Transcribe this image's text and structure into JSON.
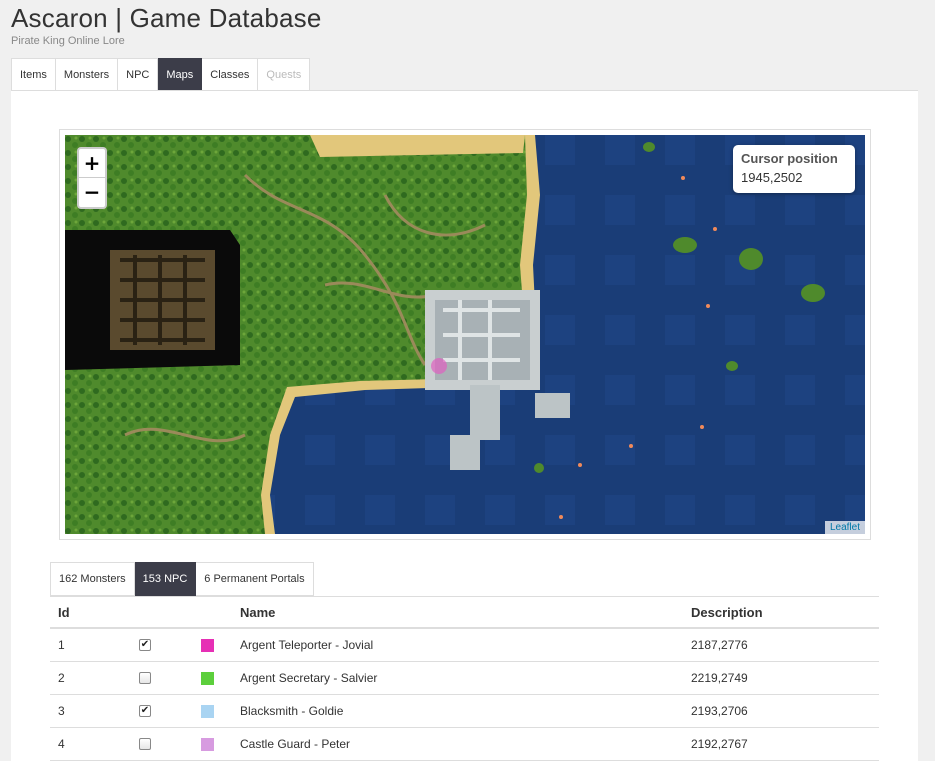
{
  "header": {
    "title": "Ascaron | Game Database",
    "subtitle": "Pirate King Online Lore"
  },
  "main_tabs": [
    {
      "label": "Items",
      "state": "normal"
    },
    {
      "label": "Monsters",
      "state": "normal"
    },
    {
      "label": "NPC",
      "state": "normal"
    },
    {
      "label": "Maps",
      "state": "active"
    },
    {
      "label": "Classes",
      "state": "normal"
    },
    {
      "label": "Quests",
      "state": "disabled"
    }
  ],
  "map": {
    "zoom_in": "+",
    "zoom_out": "−",
    "cursor_title": "Cursor position",
    "cursor_value": "1945,2502",
    "attribution": "Leaflet"
  },
  "sub_tabs": [
    {
      "label": "162 Monsters",
      "state": "normal"
    },
    {
      "label": "153 NPC",
      "state": "active"
    },
    {
      "label": "6 Permanent Portals",
      "state": "normal"
    }
  ],
  "table": {
    "headers": {
      "id": "Id",
      "name": "Name",
      "description": "Description"
    },
    "rows": [
      {
        "id": "1",
        "checked": true,
        "color": "#e62fb5",
        "name": "Argent Teleporter - Jovial",
        "description": "2187,2776"
      },
      {
        "id": "2",
        "checked": false,
        "color": "#5ccf3c",
        "name": "Argent Secretary - Salvier",
        "description": "2219,2749"
      },
      {
        "id": "3",
        "checked": true,
        "color": "#a9d4f2",
        "name": "Blacksmith - Goldie",
        "description": "2193,2706"
      },
      {
        "id": "4",
        "checked": false,
        "color": "#d79be0",
        "name": "Castle Guard - Peter",
        "description": "2192,2767"
      }
    ]
  }
}
